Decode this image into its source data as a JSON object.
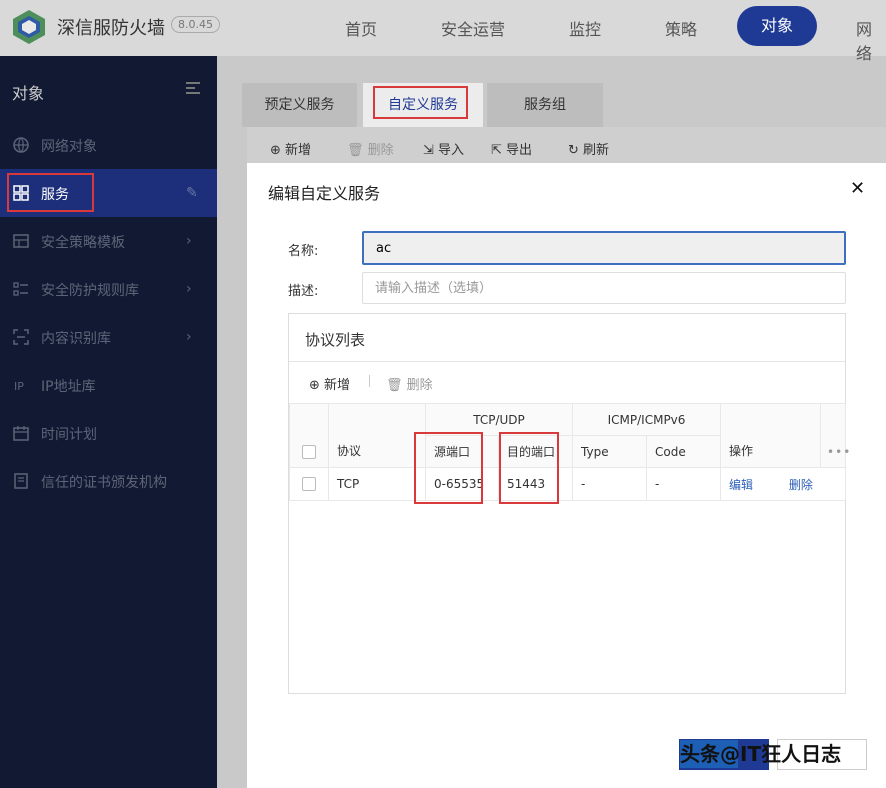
{
  "header": {
    "brand": "深信服防火墙",
    "version": "8.0.45",
    "nav": [
      "首页",
      "安全运营",
      "监控",
      "策略",
      "对象",
      "网络"
    ],
    "active_nav": "对象"
  },
  "sidebar": {
    "title": "对象",
    "items": [
      {
        "label": "网络对象",
        "icon": "globe-icon",
        "has_chevron": false
      },
      {
        "label": "服务",
        "icon": "grid-icon",
        "has_chevron": false,
        "active": true
      },
      {
        "label": "安全策略模板",
        "icon": "template-icon",
        "has_chevron": true
      },
      {
        "label": "安全防护规则库",
        "icon": "rules-icon",
        "has_chevron": true
      },
      {
        "label": "内容识别库",
        "icon": "scan-icon",
        "has_chevron": true
      },
      {
        "label": "IP地址库",
        "icon": "ip-icon",
        "has_chevron": false
      },
      {
        "label": "时间计划",
        "icon": "calendar-icon",
        "has_chevron": false
      },
      {
        "label": "信任的证书颁发机构",
        "icon": "certificate-icon",
        "has_chevron": false
      }
    ]
  },
  "tabs": [
    "预定义服务",
    "自定义服务",
    "服务组"
  ],
  "active_tab": "自定义服务",
  "toolbar": {
    "add": "新增",
    "delete": "删除",
    "import": "导入",
    "export": "导出",
    "refresh": "刷新"
  },
  "dialog": {
    "title": "编辑自定义服务",
    "name_label": "名称:",
    "name_value": "ac",
    "desc_label": "描述:",
    "desc_placeholder": "请输入描述（选填）",
    "protocol_title": "协议列表",
    "p_add": "新增",
    "p_delete": "删除",
    "table": {
      "group_tcp": "TCP/UDP",
      "group_icmp": "ICMP/ICMPv6",
      "col_protocol": "协议",
      "col_src_port": "源端口",
      "col_dst_port": "目的端口",
      "col_type": "Type",
      "col_code": "Code",
      "col_action": "操作",
      "rows": [
        {
          "protocol": "TCP",
          "src_port": "0-65535",
          "dst_port": "51443",
          "type": "-",
          "code": "-",
          "edit": "编辑",
          "delete": "删除"
        }
      ]
    }
  },
  "watermark": "头条@IT狂人日志",
  "colors": {
    "accent": "#1f3a94",
    "sidebar_bg": "#121a33",
    "highlight_red": "#d9393b",
    "link": "#2c5fb7"
  }
}
